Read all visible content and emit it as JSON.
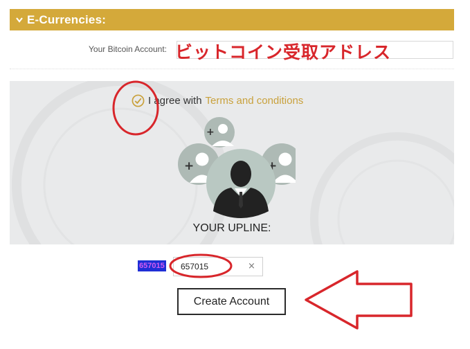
{
  "section": {
    "title": "E-Currencies:"
  },
  "bitcoin": {
    "label": "Your Bitcoin Account:",
    "value": "",
    "annotation": "ビットコイン受取アドレス"
  },
  "agreement": {
    "text": "I agree with",
    "link": "Terms and conditions",
    "checked": true
  },
  "upline": {
    "label": "YOUR UPLINE:",
    "highlight": "657015",
    "value": "657015",
    "clear": "×"
  },
  "actions": {
    "create_account": "Create Account"
  },
  "colors": {
    "accent": "#d4a93a",
    "link": "#c9a13c",
    "panel_bg": "#e9eaeb",
    "annotation_red": "#d8262b",
    "highlight_bg": "#1f2fd6"
  },
  "icons": [
    "chevron-down-icon",
    "checkmark-circle-icon",
    "user-add-icon",
    "user-icon",
    "clear-icon",
    "arrow-left-icon"
  ]
}
